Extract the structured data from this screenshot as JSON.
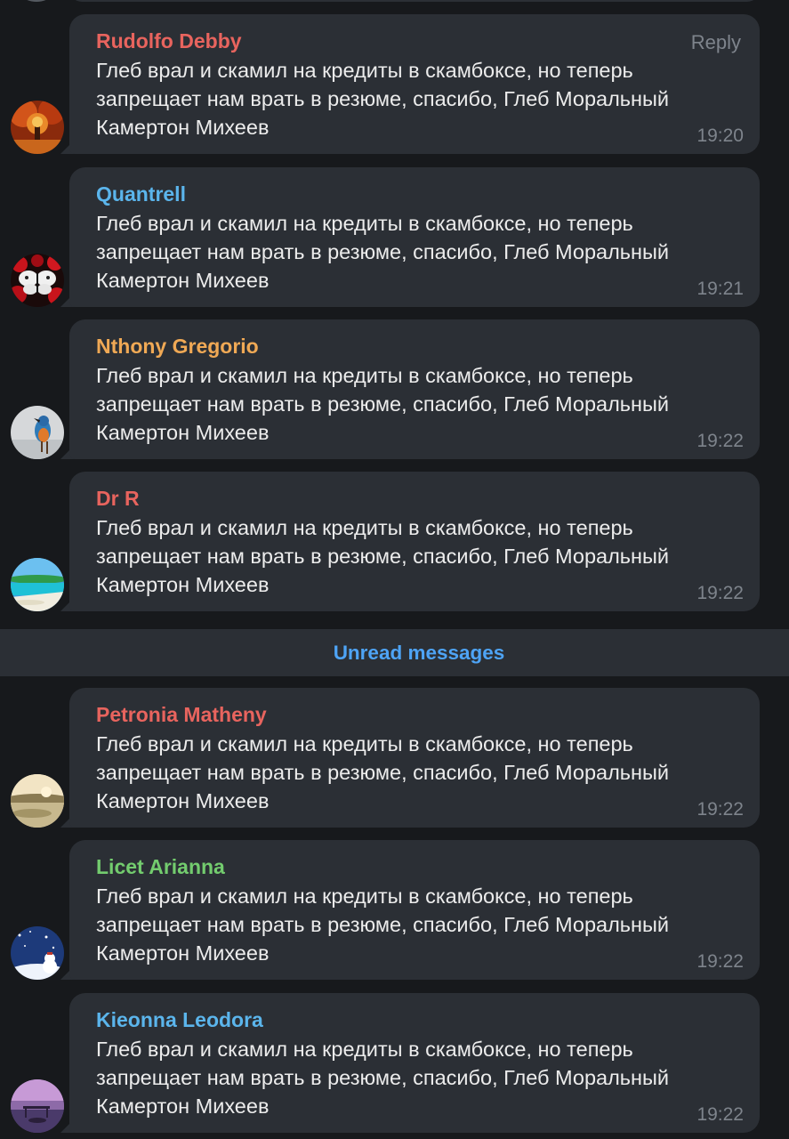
{
  "messages_before": [
    {
      "sender": "Rudolfo Debby",
      "color": "#e8645e",
      "text": "Глеб врал и скамил на кредиты в скамбоксе, но теперь запрещает нам врать в резюме, спасибо, Глеб Моральный Камертон Михеев",
      "time": "19:20",
      "reply_label": "Reply",
      "avatar": "autumn-forest-avatar"
    },
    {
      "sender": "Quantrell",
      "color": "#5bb5ec",
      "text": "Глеб врал и скамил на кредиты в скамбоксе, но теперь запрещает нам врать в резюме, спасибо, Глеб Моральный Камертон Михеев",
      "time": "19:21",
      "avatar": "butterfly-roses-avatar"
    },
    {
      "sender": "Nthony Gregorio",
      "color": "#f0a955",
      "text": "Глеб врал и скамил на кредиты в скамбоксе, но теперь запрещает нам врать в резюме, спасибо, Глеб Моральный Камертон Михеев",
      "time": "19:22",
      "avatar": "kingfisher-bird-avatar"
    },
    {
      "sender": "Dr R",
      "color": "#e8645e",
      "text": "Глеб врал и скамил на кредиты в скамбоксе, но теперь запрещает нам врать в резюме, спасибо, Глеб Моральный Камертон Михеев",
      "time": "19:22",
      "avatar": "tropical-beach-avatar"
    }
  ],
  "divider": {
    "label": "Unread messages"
  },
  "messages_after": [
    {
      "sender": "Petronia Matheny",
      "color": "#e8645e",
      "text": "Глеб врал и скамил на кредиты в скамбоксе, но теперь запрещает нам врать в резюме, спасибо, Глеб Моральный Камертон Михеев",
      "time": "19:22",
      "avatar": "sunset-lake-avatar"
    },
    {
      "sender": "Licet Arianna",
      "color": "#73cc6e",
      "text": "Глеб врал и скамил на кредиты в скамбоксе, но теперь запрещает нам врать в резюме, спасибо, Глеб Моральный Камертон Михеев",
      "time": "19:22",
      "avatar": "winter-snowman-avatar"
    },
    {
      "sender": "Kieonna Leodora",
      "color": "#5bb5ec",
      "text": "Глеб врал и скамил на кредиты в скамбоксе, но теперь запрещает нам врать в резюме, спасибо, Глеб Моральный Камертон Михеев",
      "time": "19:22",
      "avatar": "purple-dusk-lake-avatar"
    }
  ]
}
